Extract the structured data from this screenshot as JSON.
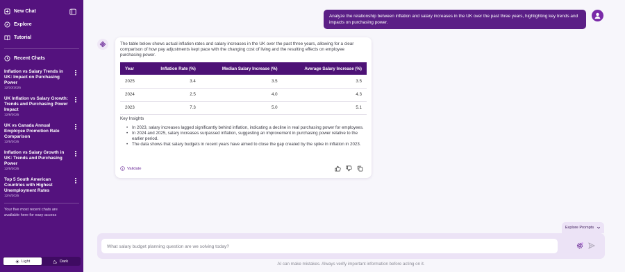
{
  "sidebar": {
    "new_chat": "New Chat",
    "explore": "Explore",
    "tutorial": "Tutorial",
    "recent_title": "Recent Chats",
    "recent_note": "Your five most recent chats are available here for easy access",
    "chats": [
      {
        "title": "Inflation vs Salary Trends in UK: Impact on Purchasing Power",
        "date": "12/10/2025"
      },
      {
        "title": "UK Inflation vs Salary Growth: Trends and Purchasing Power Impact",
        "date": "12/8/2025"
      },
      {
        "title": "UK vs Canada Annual Employee Promotion Rate Comparison",
        "date": "12/5/2025"
      },
      {
        "title": "Inflation vs Salary Growth in UK: Trends and Purchasing Power",
        "date": "12/5/2025"
      },
      {
        "title": "Top 5 South American Countries with Highest Unemployment Rates",
        "date": "12/4/2025"
      }
    ],
    "theme": {
      "light": "Light",
      "dark": "Dark"
    },
    "accent": "#54127e"
  },
  "conversation": {
    "user_prompt": "Analyze the relationship between inflation and salary increases in the UK over the past three years, highlighting key trends and impacts on purchasing power.",
    "answer_intro": "The table below shows actual inflation rates and salary increases in the UK over the past three years, allowing for a clear comparison of how pay adjustments kept pace with the changing cost of living and the resulting effects on employee purchasing power.",
    "table": {
      "headers": [
        "Year",
        "Inflation Rate (%)",
        "Median Salary Increase (%)",
        "Average Salary Increase (%)"
      ],
      "rows": [
        [
          "2025",
          "3.4",
          "3.5",
          "3.5"
        ],
        [
          "2024",
          "2.5",
          "4.0",
          "4.3"
        ],
        [
          "2023",
          "7.3",
          "5.0",
          "5.1"
        ]
      ]
    },
    "insights_title": "Key Insights",
    "insights": [
      "In 2023, salary increases lagged significantly behind inflation, indicating a decline in real purchasing power for employees.",
      "In 2024 and 2025, salary increases surpassed inflation, suggesting an improvement in purchasing power relative to the earlier period.",
      "The data shows that salary budgets in recent years have aimed to close the gap created by the spike in inflation in 2023."
    ],
    "validate_label": "Validate"
  },
  "composer": {
    "explore_prompts": "Explore Prompts",
    "placeholder": "What salary budget planning question are we solving today?",
    "disclaimer": "AI can make mistakes. Always verify important information before acting on it."
  }
}
